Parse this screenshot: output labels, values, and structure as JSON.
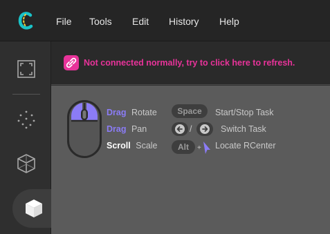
{
  "menu": {
    "file": "File",
    "tools": "Tools",
    "edit": "Edit",
    "history": "History",
    "help": "Help"
  },
  "sidebar": {
    "items": [
      {
        "icon": "frame-icon"
      },
      {
        "icon": "point-cloud-icon"
      },
      {
        "icon": "wireframe-cube-icon"
      },
      {
        "icon": "solid-cube-icon",
        "active": true
      }
    ]
  },
  "notice": {
    "text": "Not connected normally, try to click here to refresh.",
    "color": "#e8339a"
  },
  "help": {
    "mouse": [
      {
        "action": "Drag",
        "label": "Rotate"
      },
      {
        "action": "Drag",
        "label": "Pan"
      },
      {
        "action": "Scroll",
        "label": "Scale"
      }
    ],
    "keys": {
      "space_key": "Space",
      "space_label": "Start/Stop Task",
      "slash": "/",
      "switch_label": "Switch Task",
      "alt_key": "Alt",
      "plus": "+",
      "alt_label": "Locate RCenter"
    }
  },
  "colors": {
    "accent_purple": "#8b7cf6",
    "alert_pink": "#e8339a",
    "viewport_bg": "#5b5b5b"
  }
}
